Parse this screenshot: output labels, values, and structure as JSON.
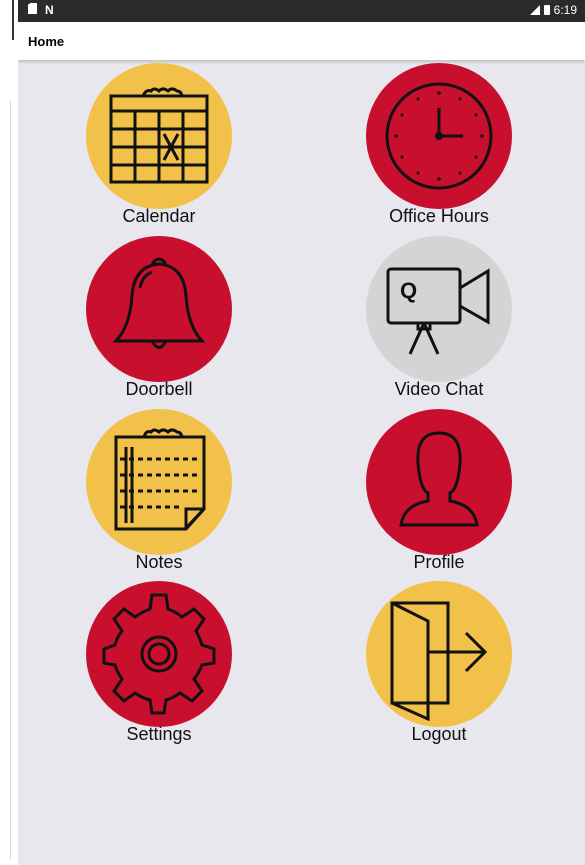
{
  "status_bar": {
    "time": "6:19",
    "n_badge": "N"
  },
  "header": {
    "title": "Home"
  },
  "colors": {
    "yellow": "#f2c14a",
    "red": "#c8102e",
    "grey": "#d4d4d4",
    "background": "#e8e7ee"
  },
  "tiles": [
    {
      "label": "Calendar",
      "icon": "calendar-icon",
      "color": "yellow"
    },
    {
      "label": "Office Hours",
      "icon": "clock-icon",
      "color": "red"
    },
    {
      "label": "Doorbell",
      "icon": "bell-icon",
      "color": "red"
    },
    {
      "label": "Video Chat",
      "icon": "video-camera-icon",
      "color": "grey"
    },
    {
      "label": "Notes",
      "icon": "notepad-icon",
      "color": "yellow"
    },
    {
      "label": "Profile",
      "icon": "person-icon",
      "color": "red"
    },
    {
      "label": "Settings",
      "icon": "gear-icon",
      "color": "red"
    },
    {
      "label": "Logout",
      "icon": "exit-door-icon",
      "color": "yellow"
    }
  ]
}
